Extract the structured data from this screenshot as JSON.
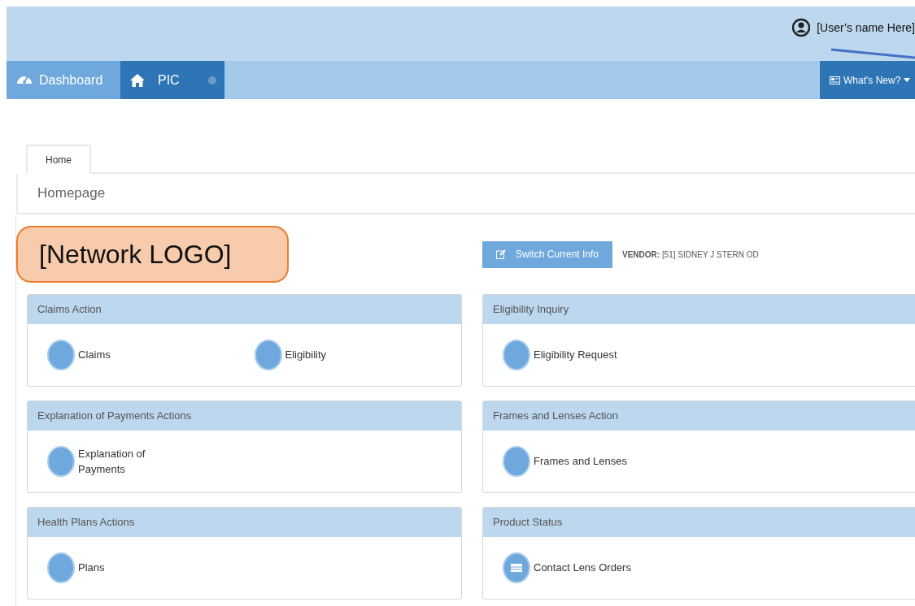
{
  "header": {
    "user_name": "[User’s name Here]"
  },
  "nav": {
    "tabs": [
      {
        "label": "Dashboard",
        "kind": "gauge",
        "selected": false
      },
      {
        "label": "PIC",
        "kind": "home",
        "selected": true
      }
    ],
    "whats_new": "What's New?"
  },
  "page_tabs": [
    {
      "label": "Home",
      "selected": true
    }
  ],
  "page_title": "Homepage",
  "logo": "[Network LOGO]",
  "switch_button": "Switch Current Info",
  "vendor": "**VENDOR:** [51] SIDNEY J STERN OD",
  "panels": [
    {
      "title": "Claims Action",
      "items": [
        {
          "label": "Claims",
          "kind": "plain"
        },
        {
          "label": "Eligibility",
          "kind": "plain"
        }
      ]
    },
    {
      "title": "Eligibility Inquiry",
      "items": [
        {
          "label": "Eligibility Request",
          "kind": "plain"
        }
      ]
    },
    {
      "title": "Explanation of Payments Actions",
      "items": [
        {
          "label": "Explanation of Payments",
          "kind": "plain"
        }
      ]
    },
    {
      "title": "Frames and Lenses Action",
      "items": [
        {
          "label": "Frames and Lenses",
          "kind": "plain"
        }
      ]
    },
    {
      "title": "Health Plans Actions",
      "items": [
        {
          "label": "Plans",
          "kind": "plain"
        }
      ]
    },
    {
      "title": "Product Status",
      "items": [
        {
          "label": "Contact Lens Orders",
          "kind": "list"
        }
      ]
    }
  ]
}
